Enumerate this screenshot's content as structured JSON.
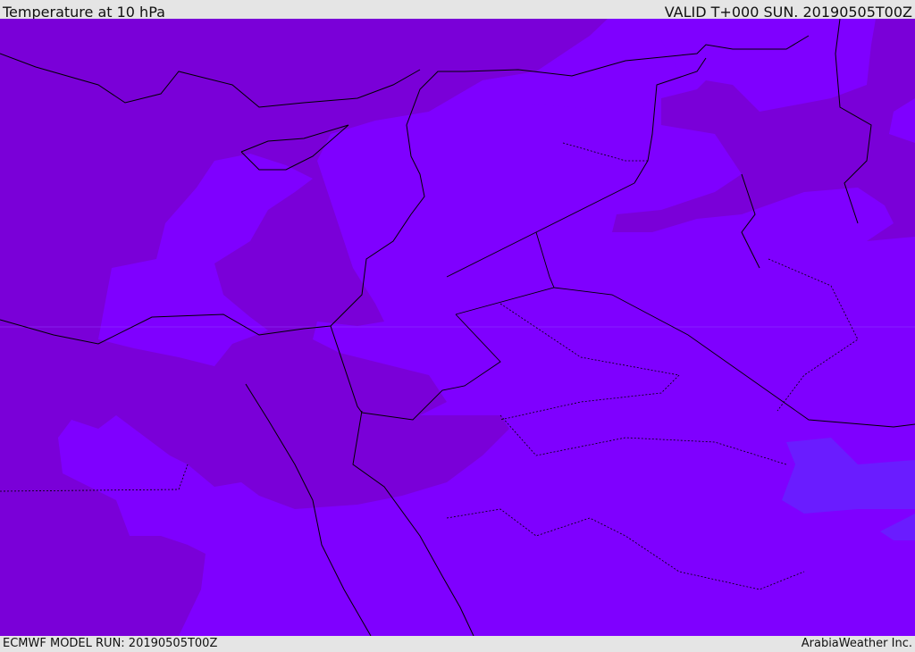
{
  "header": {
    "title": "Temperature at 10 hPa",
    "valid": "VALID T+000 SUN. 20190505T00Z"
  },
  "footer": {
    "model_run": "ECMWF MODEL RUN: 20190505T00Z",
    "credit": "ArabiaWeather Inc."
  },
  "colors": {
    "warm_band": "#7f00ff",
    "cool_band": "#7a00d8",
    "cold_band": "#6a1cff",
    "coastline": "#000000"
  }
}
